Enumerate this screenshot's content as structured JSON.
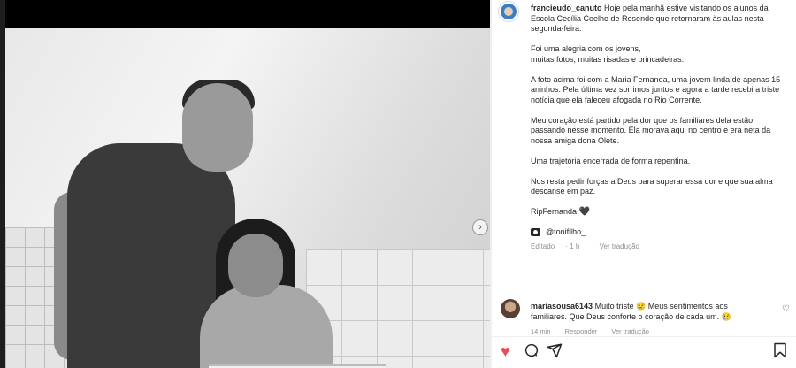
{
  "post": {
    "username": "francieudo_canuto",
    "caption": [
      "Hoje pela manhã estive visitando os alunos da Escola Cecília Coelho de Resende que retornaram às aulas nesta segunda-feira.",
      "Foi uma alegria com os jovens,\nmuitas fotos, muitas risadas e brincadeiras.",
      "A foto acima foi com a Maria Fernanda, uma jovem linda de apenas 15 aninhos. Pela última vez sorrimos juntos e agora a tarde recebi a triste notícia que ela faleceu afogada no Rio Corrente.",
      "Meu coração está partido pela dor que os familiares dela estão passando nesse momento. Ela morava aqui no centro e era neta da nossa amiga dona Olete.",
      "Uma trajetória encerrada de forma repentina.",
      "Nos resta pedir forças a Deus para superar essa dor e que sua alma descanse em paz.",
      "RipFernanda"
    ],
    "heart_emoji": "🖤",
    "tagged_user": "@tonifilho_",
    "meta": {
      "status": "Editado",
      "time": "1 h",
      "translate": "Ver tradução"
    }
  },
  "comment": {
    "username": "mariasousa6143",
    "text": "Muito triste 😢 Meus sentimentos aos familiares. Que Deus conforte o coração de cada um. 😢",
    "time": "14 min",
    "reply": "Responder",
    "translate": "Ver tradução"
  },
  "icons": {
    "like": "heart-filled-icon",
    "comment": "comment-icon",
    "share": "share-icon",
    "save": "bookmark-icon",
    "next": "chevron-right-icon"
  },
  "colors": {
    "like_active": "#ed4956",
    "text": "#262626",
    "muted": "#8e8e8e"
  }
}
